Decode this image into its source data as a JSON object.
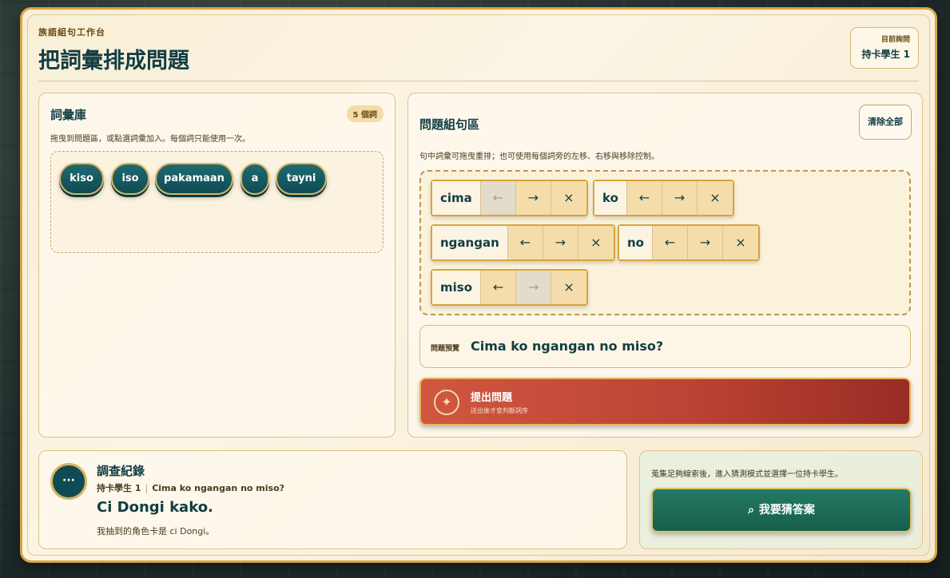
{
  "header": {
    "eyebrow": "族語組句工作台",
    "title": "把詞彙排成問題",
    "asker_label": "目前詢問",
    "asker_value": "持卡學生 1"
  },
  "bank": {
    "title": "詞彙庫",
    "count_badge": "5 個詞",
    "hint": "拖曳到問題區，或點選詞彙加入。每個詞只能使用一次。",
    "words": [
      "kiso",
      "iso",
      "pakamaan",
      "a",
      "tayni"
    ]
  },
  "compose": {
    "title": "問題組句區",
    "clear_label": "清除全部",
    "hint": "句中詞彙可拖曳重排；也可使用每個詞旁的左移、右移與移除控制。",
    "tokens": [
      "cima",
      "ko",
      "ngangan",
      "no",
      "miso"
    ],
    "controls": {
      "left": "←",
      "right": "→",
      "remove": "×"
    },
    "preview_label": "問題預覽",
    "preview_text": "Cima ko ngangan no miso?",
    "submit_icon": "✦",
    "submit_title": "提出問題",
    "submit_sub": "送出後才會判斷詞序"
  },
  "log": {
    "avatar": "···",
    "title": "調查紀錄",
    "student": "持卡學生 1",
    "question": "Cima ko ngangan no miso?",
    "answer": "Ci Dongi kako.",
    "note": "我抽到的角色卡是 ci Dongi。"
  },
  "guess": {
    "hint": "蒐集足夠線索後，進入猜測模式並選擇一位持卡學生。",
    "icon": "⌕",
    "button_label": "我要猜答案"
  },
  "colors": {
    "accent_teal": "#123d44",
    "submit_red": "#bb4334",
    "guess_green": "#1d6e5a",
    "gold_border": "#d9a548"
  }
}
